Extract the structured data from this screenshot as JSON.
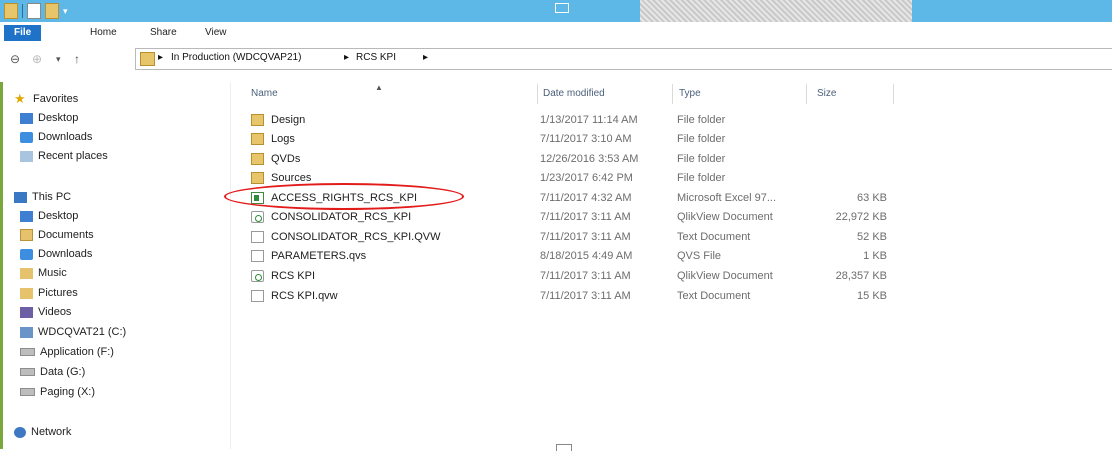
{
  "ribbon": {
    "tabs": [
      "File",
      "Home",
      "Share",
      "View"
    ]
  },
  "address": {
    "crumbs": [
      "In Production (WDCQVAP21)",
      "RCS KPI"
    ],
    "separator": "▸"
  },
  "sidebar": {
    "favorites_label": "Favorites",
    "favorites": [
      "Desktop",
      "Downloads",
      "Recent places"
    ],
    "this_pc_label": "This PC",
    "this_pc": [
      "Desktop",
      "Documents",
      "Downloads",
      "Music",
      "Pictures",
      "Videos",
      "WDCQVAT21 (C:)",
      "Application (F:)",
      "Data (G:)",
      "Paging (X:)"
    ],
    "network_label": "Network"
  },
  "columns": {
    "name": "Name",
    "date": "Date modified",
    "type": "Type",
    "size": "Size"
  },
  "files": [
    {
      "name": "Design",
      "date": "1/13/2017 11:14 AM",
      "type": "File folder",
      "size": "",
      "icon": "folder-icon"
    },
    {
      "name": "Logs",
      "date": "7/11/2017 3:10 AM",
      "type": "File folder",
      "size": "",
      "icon": "folder-icon"
    },
    {
      "name": "QVDs",
      "date": "12/26/2016 3:53 AM",
      "type": "File folder",
      "size": "",
      "icon": "folder-icon"
    },
    {
      "name": "Sources",
      "date": "1/23/2017 6:42 PM",
      "type": "File folder",
      "size": "",
      "icon": "folder-icon"
    },
    {
      "name": "ACCESS_RIGHTS_RCS_KPI",
      "date": "7/11/2017 4:32 AM",
      "type": "Microsoft Excel 97...",
      "size": "63 KB",
      "icon": "excel-icon"
    },
    {
      "name": "CONSOLIDATOR_RCS_KPI",
      "date": "7/11/2017 3:11 AM",
      "type": "QlikView Document",
      "size": "22,972 KB",
      "icon": "qlikview-icon"
    },
    {
      "name": "CONSOLIDATOR_RCS_KPI.QVW",
      "date": "7/11/2017 3:11 AM",
      "type": "Text Document",
      "size": "52 KB",
      "icon": "text-document-icon"
    },
    {
      "name": "PARAMETERS.qvs",
      "date": "8/18/2015 4:49 AM",
      "type": "QVS File",
      "size": "1 KB",
      "icon": "qvs-file-icon"
    },
    {
      "name": "RCS KPI",
      "date": "7/11/2017 3:11 AM",
      "type": "QlikView Document",
      "size": "28,357 KB",
      "icon": "qlikview-icon"
    },
    {
      "name": "RCS KPI.qvw",
      "date": "7/11/2017 3:11 AM",
      "type": "Text Document",
      "size": "15 KB",
      "icon": "text-document-icon"
    }
  ],
  "colors": {
    "titlebar": "#5db8e8",
    "file_tab": "#1e73c8",
    "highlight_circle": "#e21b1b"
  }
}
